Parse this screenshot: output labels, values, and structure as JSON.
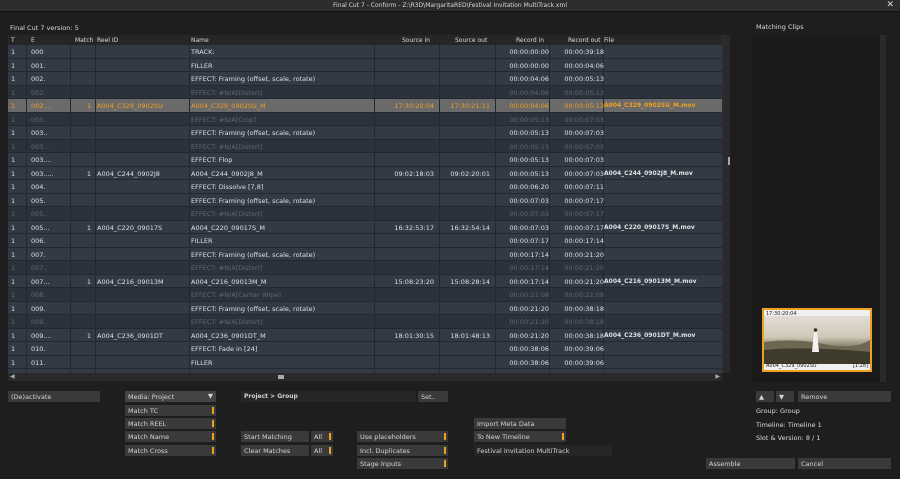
{
  "window": {
    "title": "Final Cut 7 - Conform - Z:\\R3D\\MargaritaRED\\Festival Invitation MultiTrack.xml",
    "close": "✕"
  },
  "version_label": "Final Cut 7 version: 5",
  "columns": [
    "T",
    "E",
    "Match",
    "Reel ID",
    "Name",
    "Source in",
    "Source out",
    "Record in",
    "Record out",
    "File"
  ],
  "rows": [
    {
      "t": "1",
      "e": "000",
      "match": "",
      "reel": "",
      "name": "TRACK:",
      "sin": "",
      "sout": "",
      "rin": "00:00:00:00",
      "rout": "00:00:39:18",
      "file": "",
      "state": "normal"
    },
    {
      "t": "1",
      "e": "001.",
      "match": "",
      "reel": "",
      "name": "FILLER",
      "sin": "",
      "sout": "",
      "rin": "00:00:00:00",
      "rout": "00:00:04:06",
      "file": "",
      "state": "normal"
    },
    {
      "t": "1",
      "e": "002.",
      "match": "",
      "reel": "",
      "name": "EFFECT: Framing (offset, scale, rotate)",
      "sin": "",
      "sout": "",
      "rin": "00:00:04:06",
      "rout": "00:00:05:13",
      "file": "",
      "state": "normal"
    },
    {
      "t": "1",
      "e": "002.",
      "match": "",
      "reel": "",
      "name": "EFFECT: #N/A[Distort]",
      "sin": "",
      "sout": "",
      "rin": "00:00:04:06",
      "rout": "00:00:05:13",
      "file": "",
      "state": "dim"
    },
    {
      "t": "1",
      "e": "002....",
      "match": "1",
      "reel": "A004_C329_0902SU",
      "name": "A004_C329_0902SU_M",
      "sin": "17:30:20:04",
      "sout": "17:30:21:11",
      "rin": "00:00:04:06",
      "rout": "00:00:05:13",
      "file": "A004_C329_0902SU_M.mov",
      "state": "sel"
    },
    {
      "t": "1",
      "e": "003.",
      "match": "",
      "reel": "",
      "name": "EFFECT: #N/A[Crop]",
      "sin": "",
      "sout": "",
      "rin": "00:00:05:13",
      "rout": "00:00:07:03",
      "file": "",
      "state": "dim"
    },
    {
      "t": "1",
      "e": "003..",
      "match": "",
      "reel": "",
      "name": "EFFECT: Framing (offset, scale, rotate)",
      "sin": "",
      "sout": "",
      "rin": "00:00:05:13",
      "rout": "00:00:07:03",
      "file": "",
      "state": "normal"
    },
    {
      "t": "1",
      "e": "003...",
      "match": "",
      "reel": "",
      "name": "EFFECT: #N/A[Distort]",
      "sin": "",
      "sout": "",
      "rin": "00:00:05:13",
      "rout": "00:00:07:03",
      "file": "",
      "state": "dim"
    },
    {
      "t": "1",
      "e": "003....",
      "match": "",
      "reel": "",
      "name": "EFFECT: Flop",
      "sin": "",
      "sout": "",
      "rin": "00:00:05:13",
      "rout": "00:00:07:03",
      "file": "",
      "state": "normal"
    },
    {
      "t": "1",
      "e": "003.....",
      "match": "1",
      "reel": "A004_C244_0902J8",
      "name": "A004_C244_0902J8_M",
      "sin": "09:02:18:03",
      "sout": "09:02:20:01",
      "rin": "00:00:05:13",
      "rout": "00:00:07:03",
      "file": "A004_C244_0902J8_M.mov",
      "state": "normal"
    },
    {
      "t": "1",
      "e": "004.",
      "match": "",
      "reel": "",
      "name": "EFFECT: Dissolve [7,8]",
      "sin": "",
      "sout": "",
      "rin": "00:00:06:20",
      "rout": "00:00:07:11",
      "file": "",
      "state": "normal"
    },
    {
      "t": "1",
      "e": "005.",
      "match": "",
      "reel": "",
      "name": "EFFECT: Framing (offset, scale, rotate)",
      "sin": "",
      "sout": "",
      "rin": "00:00:07:03",
      "rout": "00:00:07:17",
      "file": "",
      "state": "normal"
    },
    {
      "t": "1",
      "e": "005..",
      "match": "",
      "reel": "",
      "name": "EFFECT: #N/A[Distort]",
      "sin": "",
      "sout": "",
      "rin": "00:00:07:03",
      "rout": "00:00:07:17",
      "file": "",
      "state": "dim"
    },
    {
      "t": "1",
      "e": "005...",
      "match": "1",
      "reel": "A004_C220_09017S",
      "name": "A004_C220_09017S_M",
      "sin": "16:32:53:17",
      "sout": "16:32:54:14",
      "rin": "00:00:07:03",
      "rout": "00:00:07:17",
      "file": "A004_C220_09017S_M.mov",
      "state": "normal"
    },
    {
      "t": "1",
      "e": "006.",
      "match": "",
      "reel": "",
      "name": "FILLER",
      "sin": "",
      "sout": "",
      "rin": "00:00:07:17",
      "rout": "00:00:17:14",
      "file": "",
      "state": "normal"
    },
    {
      "t": "1",
      "e": "007.",
      "match": "",
      "reel": "",
      "name": "EFFECT: Framing (offset, scale, rotate)",
      "sin": "",
      "sout": "",
      "rin": "00:00:17:14",
      "rout": "00:00:21:20",
      "file": "",
      "state": "normal"
    },
    {
      "t": "1",
      "e": "007..",
      "match": "",
      "reel": "",
      "name": "EFFECT: #N/A[Distort]",
      "sin": "",
      "sout": "",
      "rin": "00:00:17:14",
      "rout": "00:00:21:20",
      "file": "",
      "state": "dim"
    },
    {
      "t": "1",
      "e": "007...",
      "match": "1",
      "reel": "A004_C216_09013M",
      "name": "A004_C216_09013M_M",
      "sin": "15:08:23:20",
      "sout": "15:08:28:14",
      "rin": "00:00:17:14",
      "rout": "00:00:21:20",
      "file": "A004_C216_09013M_M.mov",
      "state": "normal"
    },
    {
      "t": "1",
      "e": "008.",
      "match": "",
      "reel": "",
      "name": "EFFECT: #N/A[Center Wipe]",
      "sin": "",
      "sout": "",
      "rin": "00:00:21:08",
      "rout": "00:00:22:08",
      "file": "",
      "state": "dim"
    },
    {
      "t": "1",
      "e": "009.",
      "match": "",
      "reel": "",
      "name": "EFFECT: Framing (offset, scale, rotate)",
      "sin": "",
      "sout": "",
      "rin": "00:00:21:20",
      "rout": "00:00:38:18",
      "file": "",
      "state": "normal"
    },
    {
      "t": "1",
      "e": "009..",
      "match": "",
      "reel": "",
      "name": "EFFECT: #N/A[Distort]",
      "sin": "",
      "sout": "",
      "rin": "00:00:21:20",
      "rout": "00:00:38:18",
      "file": "",
      "state": "dim"
    },
    {
      "t": "1",
      "e": "009....",
      "match": "1",
      "reel": "A004_C236_0901DT",
      "name": "A004_C236_0901DT_M",
      "sin": "18:01:30:15",
      "sout": "18:01:48:13",
      "rin": "00:00:21:20",
      "rout": "00:00:38:18",
      "file": "A004_C236_0901DT_M.mov",
      "state": "normal"
    },
    {
      "t": "1",
      "e": "010.",
      "match": "",
      "reel": "",
      "name": "EFFECT: Fade in [24]",
      "sin": "",
      "sout": "",
      "rin": "00:00:38:06",
      "rout": "00:00:39:06",
      "file": "",
      "state": "normal"
    },
    {
      "t": "1",
      "e": "011.",
      "match": "",
      "reel": "",
      "name": "FILLER",
      "sin": "",
      "sout": "",
      "rin": "00:00:38:06",
      "rout": "00:00:39:06",
      "file": "",
      "state": "normal"
    },
    {
      "t": "1",
      "e": "012.",
      "match": "",
      "reel": "",
      "name": "TRACK:",
      "sin": "",
      "sout": "",
      "rin": "00:00:38:18",
      "rout": "00:00:39:18",
      "file": "",
      "state": "normal"
    }
  ],
  "scroll": {
    "left": "◀",
    "right": "▶"
  },
  "controls": {
    "deactivate": "(De)activate",
    "media_select": "Media: Project",
    "match_tc": "Match TC",
    "match_reel": "Match REEL",
    "match_name": "Match Name",
    "match_cross": "Match Cross",
    "path": "Project > Group",
    "set": "Set..",
    "start_matching": "Start Matching",
    "clear_matches": "Clear Matches",
    "all1": "All",
    "all2": "All",
    "use_placeholders": "Use placeholders",
    "incl_duplicates": "Incl. Duplicates",
    "stage_inputs": "Stage Inputs",
    "import_meta": "Import Meta Data",
    "to_new_timeline": "To New Timeline",
    "timeline_name": "Festival Invitation MultiTrack",
    "assemble": "Assemble",
    "cancel": "Cancel"
  },
  "right": {
    "title": "Matching Clips",
    "thumb_tc": "17:30:20:04",
    "thumb_name": "A004_C329_0902SU",
    "thumb_badge": "[1:28]",
    "up": "▲",
    "down": "▼",
    "remove": "Remove",
    "group": "Group: Group",
    "timeline": "Timeline: Timeline 1",
    "slot": "Slot & Version: 8 / 1"
  }
}
